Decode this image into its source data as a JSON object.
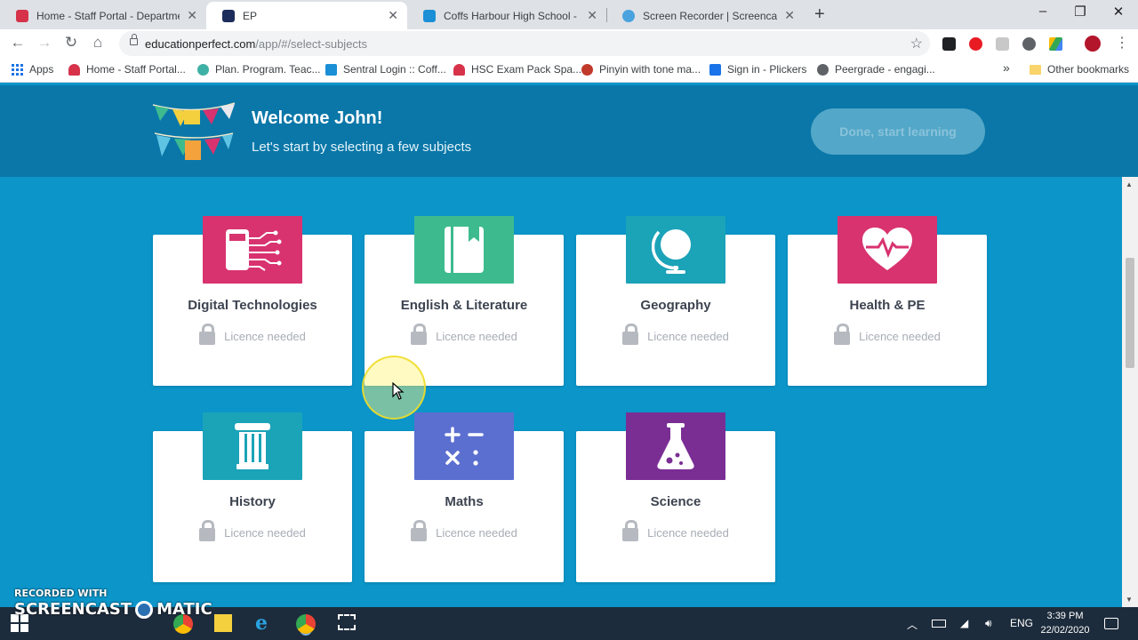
{
  "browser": {
    "tabs": [
      {
        "title": "Home - Staff Portal - Department",
        "favicon_color": "#d6334a",
        "active": false
      },
      {
        "title": "EP",
        "favicon_color": "#1d2c5a",
        "active": true
      },
      {
        "title": "Coffs Harbour High School - Das",
        "favicon_color": "#1a8fd6",
        "active": false
      },
      {
        "title": "Screen Recorder | Screencast-O-",
        "favicon_color": "#4aa3df",
        "active": false
      }
    ],
    "close_glyph": "✕",
    "new_tab_glyph": "+",
    "window_controls": {
      "minimize": "–",
      "maximize": "❐",
      "close": "✕"
    },
    "nav": {
      "back": "←",
      "forward": "→",
      "reload": "↻",
      "home": "⌂"
    },
    "url": {
      "host": "educationperfect.com",
      "path": "/app/#/select-subjects"
    },
    "star_glyph": "☆",
    "menu_glyph": "⋮",
    "bookmarks": [
      {
        "label": "Apps",
        "icon": "apps-grid-icon",
        "color": "#1a73e8"
      },
      {
        "label": "Home - Staff Portal...",
        "icon": "nsw-icon",
        "color": "#d6334a"
      },
      {
        "label": "Plan. Program. Teac...",
        "icon": "leaf-icon",
        "color": "#3fb0a5"
      },
      {
        "label": "Sentral Login :: Coff...",
        "icon": "sentral-icon",
        "color": "#1a8fd6"
      },
      {
        "label": "HSC Exam Pack Spa...",
        "icon": "nsw-icon",
        "color": "#d6334a"
      },
      {
        "label": "Pinyin with tone ma...",
        "icon": "pin-icon",
        "color": "#c0392b"
      },
      {
        "label": "Sign in - Plickers",
        "icon": "check-icon",
        "color": "#1a73e8"
      },
      {
        "label": "Peergrade - engagi...",
        "icon": "globe-icon",
        "color": "#5f6368"
      }
    ],
    "more_bookmarks_glyph": "»",
    "other_bookmarks": "Other bookmarks"
  },
  "header": {
    "welcome": "Welcome John!",
    "subtitle": "Let's start by selecting a few subjects",
    "done_button": "Done, start learning"
  },
  "subjects": [
    {
      "name": "Digital Technologies",
      "status": "Licence needed",
      "color": "#d8336f",
      "icon": "circuit-icon"
    },
    {
      "name": "English & Literature",
      "status": "Licence needed",
      "color": "#3dbb8f",
      "icon": "book-icon"
    },
    {
      "name": "Geography",
      "status": "Licence needed",
      "color": "#1ba3b8",
      "icon": "globe-icon"
    },
    {
      "name": "Health & PE",
      "status": "Licence needed",
      "color": "#d8336f",
      "icon": "heartbeat-icon"
    },
    {
      "name": "History",
      "status": "Licence needed",
      "color": "#1ba3b8",
      "icon": "column-icon"
    },
    {
      "name": "Maths",
      "status": "Licence needed",
      "color": "#5b6fd0",
      "icon": "math-symbols-icon"
    },
    {
      "name": "Science",
      "status": "Licence needed",
      "color": "#7a2e94",
      "icon": "flask-icon"
    }
  ],
  "watermark": {
    "line1": "RECORDED WITH",
    "line2a": "SCREENCAST",
    "line2b": "MATIC"
  },
  "taskbar": {
    "language": "ENG",
    "time": "3:39 PM",
    "date": "22/02/2020"
  }
}
